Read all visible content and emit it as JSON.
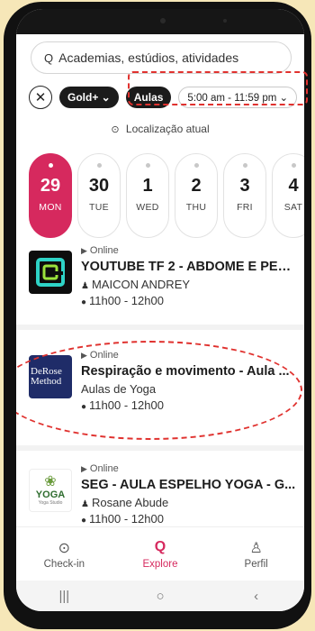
{
  "search": {
    "icon": "search-icon",
    "placeholder": "Academias, estúdios, atividades"
  },
  "filters": {
    "close": "✕",
    "plan": "Gold+ ⌄",
    "category": "Aulas",
    "time_range": "5:00 am - 11:59 pm ⌄"
  },
  "location": {
    "icon": "location-pin-icon",
    "label": "Localização atual"
  },
  "dates": [
    {
      "num": "29",
      "weekday": "MON",
      "selected": true
    },
    {
      "num": "30",
      "weekday": "TUE"
    },
    {
      "num": "1",
      "weekday": "WED"
    },
    {
      "num": "2",
      "weekday": "THU"
    },
    {
      "num": "3",
      "weekday": "FRI"
    },
    {
      "num": "4",
      "weekday": "SAT"
    }
  ],
  "events": [
    {
      "mode": "Online",
      "title": "YOUTUBE TF 2 - ABDOME E PER...",
      "subtitle": "MAICON ANDREY",
      "subtitle_icon": "person-icon",
      "time": "11h00 - 12h00",
      "logo": "G"
    },
    {
      "mode": "Online",
      "title": "Respiração  e movimento - Aula ...",
      "subtitle": "Aulas de Yoga",
      "time": "11h00 - 12h00",
      "logo_line1": "DeRose",
      "logo_line2": "Method"
    },
    {
      "mode": "Online",
      "title": "SEG - AULA ESPELHO YOGA - G...",
      "subtitle": "Rosane Abude",
      "subtitle_icon": "person-icon",
      "time": "11h00 - 12h00",
      "logo_text": "YOGA",
      "logo_sub": "Yoga Studio"
    }
  ],
  "tabs": [
    {
      "label": "Check-in",
      "icon": "check-circle-icon"
    },
    {
      "label": "Explore",
      "icon": "search-icon",
      "active": true
    },
    {
      "label": "Perfil",
      "icon": "person-icon"
    }
  ],
  "accent_color": "#d6295e",
  "annotation_color": "#e0322f"
}
